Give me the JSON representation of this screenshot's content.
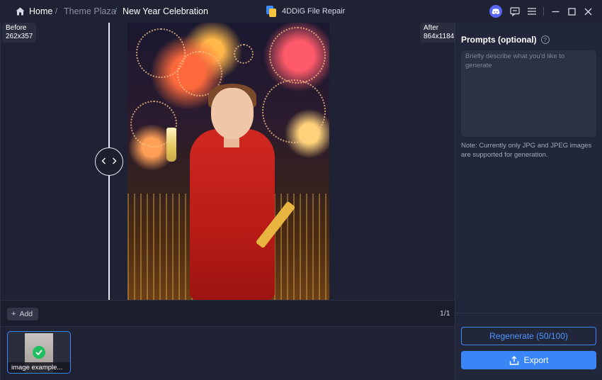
{
  "breadcrumb": {
    "home": "Home",
    "separator": "/",
    "section": "Theme Plaza",
    "current": "New Year Celebration"
  },
  "app": {
    "title": "4DDiG File Repair"
  },
  "window_controls": {
    "icons": [
      "discord-icon",
      "feedback-icon",
      "menu-icon",
      "minimize-icon",
      "maximize-icon",
      "close-icon"
    ]
  },
  "preview": {
    "before_label": "Before",
    "before_size": "262x357",
    "after_label": "After",
    "after_size": "864x1184",
    "compare_handle_icons": [
      "chevron-left-icon",
      "chevron-right-icon"
    ]
  },
  "toolbar": {
    "add_label": "Add",
    "page_count": "1/1"
  },
  "thumbnails": [
    {
      "name": "image example...",
      "selected": true,
      "status": "done"
    }
  ],
  "panel": {
    "prompts_title": "Prompts (optional)",
    "help_glyph": "?",
    "prompt_placeholder": "Briefly describe what you'd like to generate",
    "prompt_value": "",
    "note": "Note: Currently only JPG and JPEG images are supported for generation.",
    "regenerate_label": "Regenerate (50/100)",
    "export_label": "Export"
  },
  "colors": {
    "accent": "#3b86f7",
    "success": "#1fbf5f",
    "background": "#1b1e2d",
    "panel": "#22263a"
  }
}
